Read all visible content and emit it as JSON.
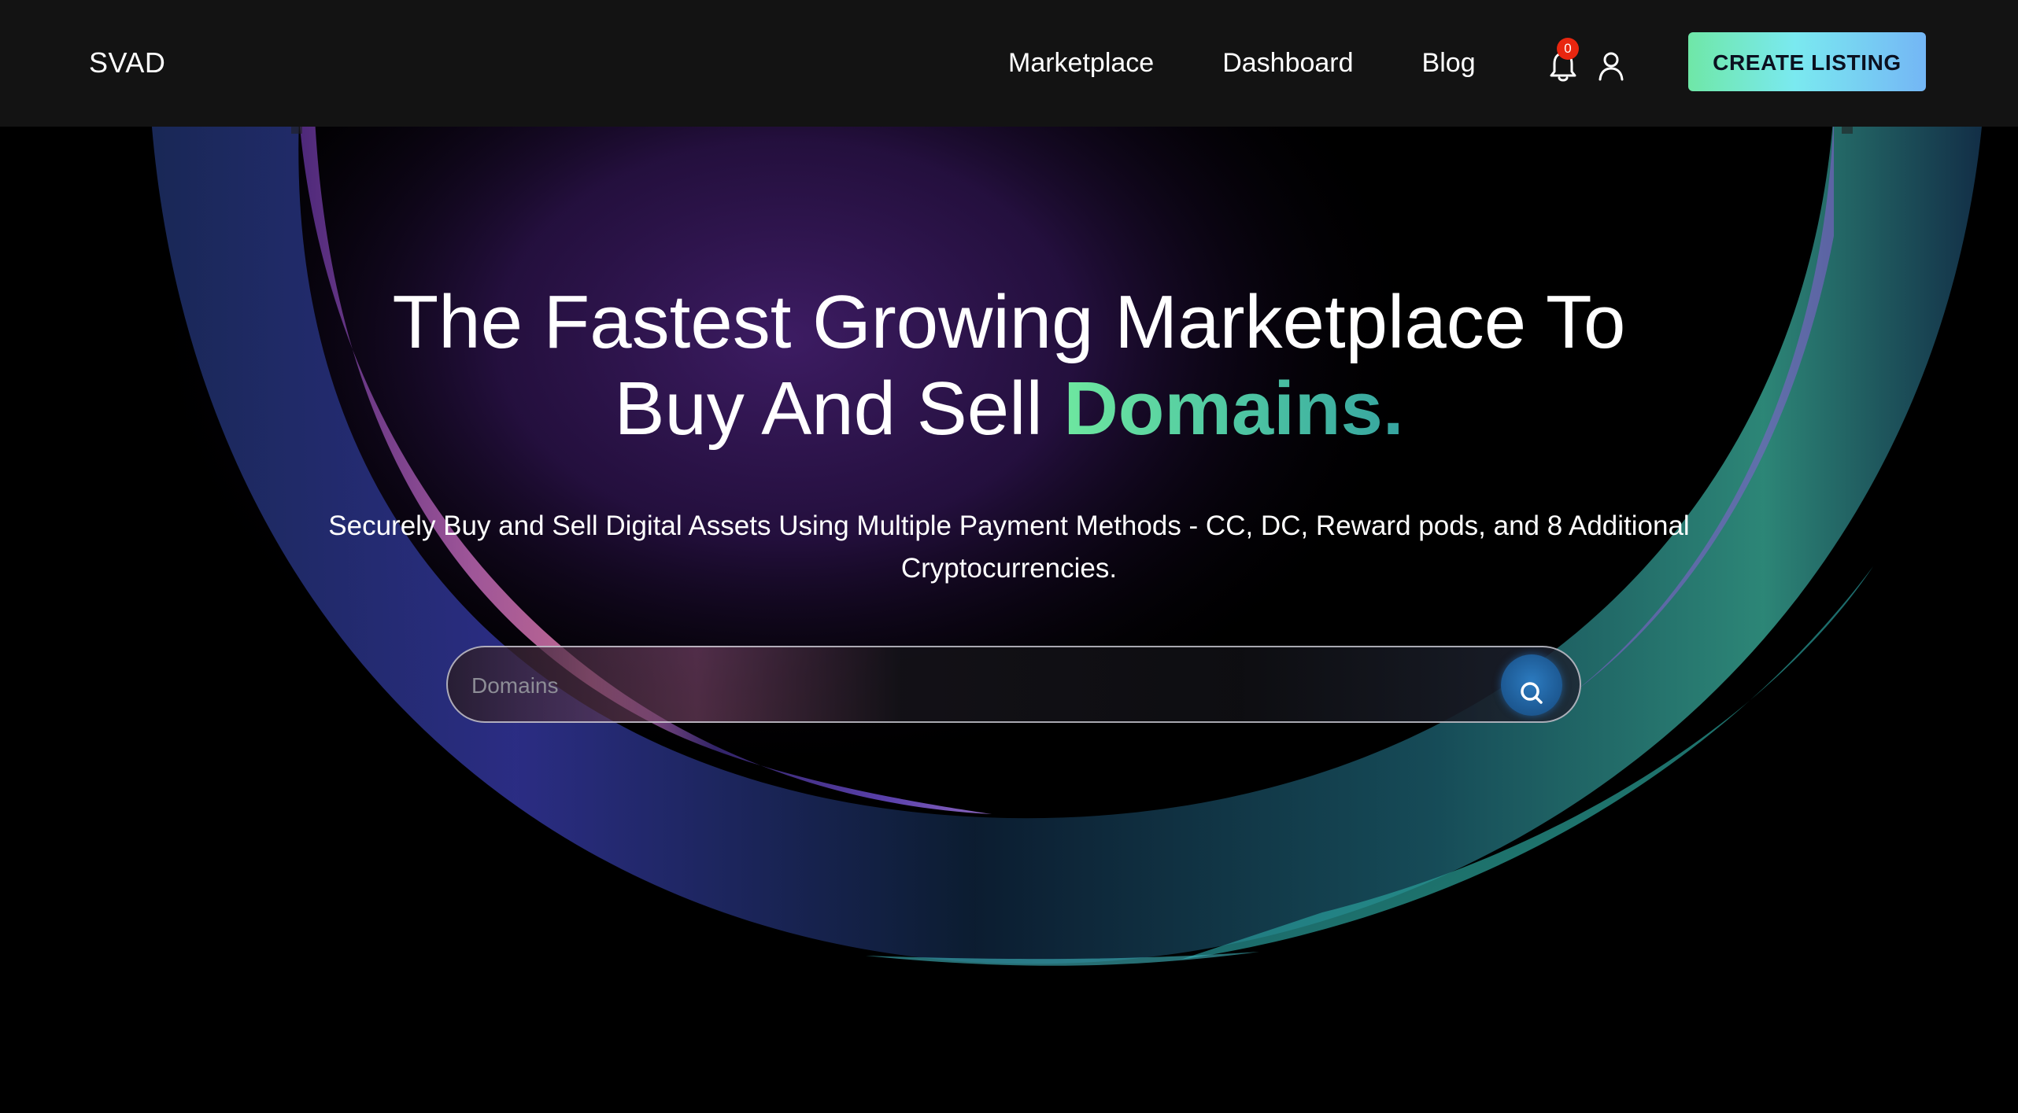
{
  "header": {
    "logo": "SVAD",
    "nav": [
      "Marketplace",
      "Dashboard",
      "Blog"
    ],
    "notification_count": "0",
    "cta_label": "CREATE LISTING"
  },
  "hero": {
    "title_line1": "The Fastest Growing Marketplace To",
    "title_line2_prefix": "Buy And Sell ",
    "title_accent": "Domains.",
    "subtitle_line1": "Securely Buy and Sell Digital Assets Using Multiple Payment Methods - CC, DC, Reward pods, and 8 Additional",
    "subtitle_line2": "Cryptocurrencies."
  },
  "search": {
    "placeholder": "Domains",
    "value": ""
  },
  "icons": {
    "bell": "bell-icon",
    "user": "user-icon",
    "search": "search-icon"
  },
  "colors": {
    "header_bg": "#131313",
    "accent_green": "#6ee7a0",
    "badge_red": "#e8260f",
    "cta_gradient_start": "#6fe7a7",
    "cta_gradient_end": "#74b6f5",
    "search_button": "#1e5c97"
  }
}
